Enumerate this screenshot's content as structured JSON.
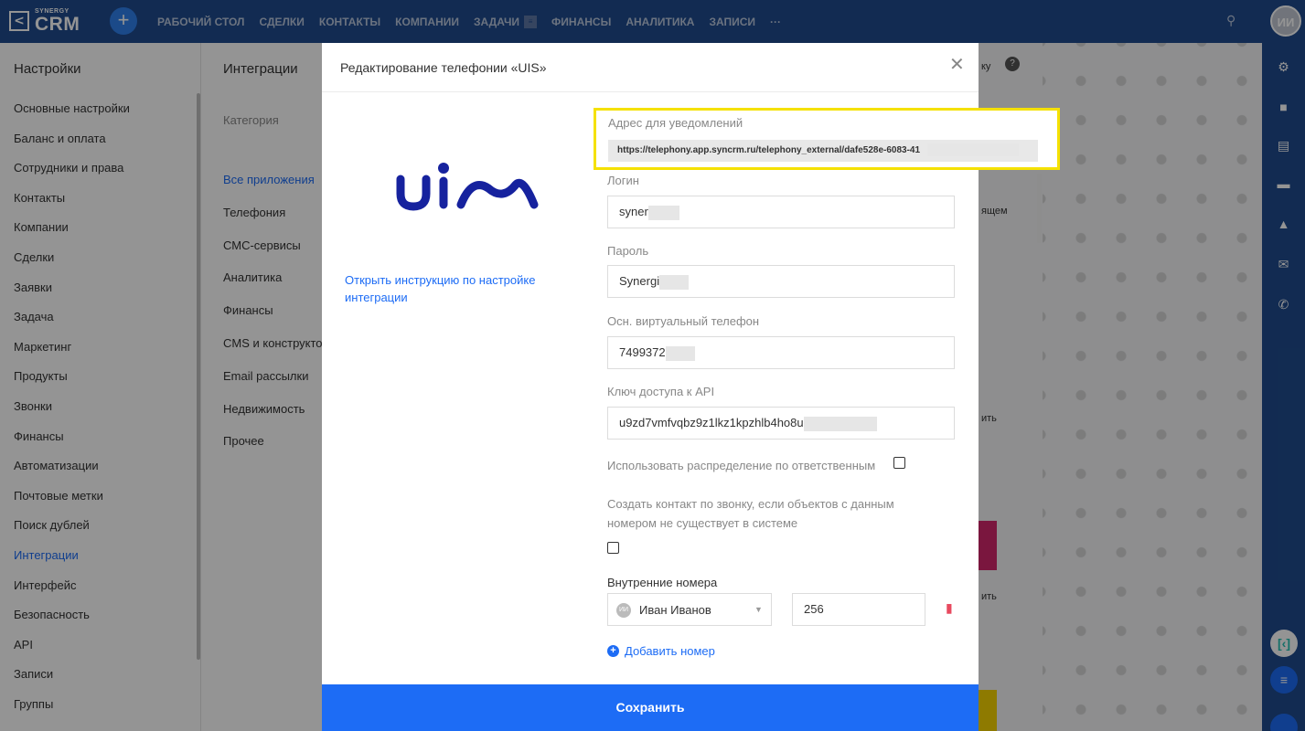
{
  "topbar": {
    "logo_small": "SYNERGY",
    "logo_big": "CRM",
    "nav": [
      "РАБОЧИЙ СТОЛ",
      "СДЕЛКИ",
      "КОНТАКТЫ",
      "КОМПАНИИ",
      "ЗАДАЧИ",
      "ФИНАНСЫ",
      "АНАЛИТИКА",
      "ЗАПИСИ",
      "···"
    ],
    "avatar": "ИИ"
  },
  "settings": {
    "title": "Настройки",
    "items": [
      "Основные настройки",
      "Баланс и оплата",
      "Сотрудники и права",
      "Контакты",
      "Компании",
      "Сделки",
      "Заявки",
      "Задача",
      "Маркетинг",
      "Продукты",
      "Звонки",
      "Финансы",
      "Автоматизации",
      "Почтовые метки",
      "Поиск дублей",
      "Интеграции",
      "Интерфейс",
      "Безопасность",
      "API",
      "Записи",
      "Группы"
    ],
    "active": "Интеграции"
  },
  "integrations": {
    "title": "Интеграции",
    "category_label": "Категория",
    "items": [
      "Все приложения",
      "Телефония",
      "СМС-сервисы",
      "Аналитика",
      "Финансы",
      "CMS и конструкто",
      "Email рассылки",
      "Недвижимость",
      "Прочее"
    ],
    "active": "Все приложения"
  },
  "background_peek": {
    "help": "ку",
    "t1": "ящем",
    "t2": "ить",
    "t3": "ить"
  },
  "modal": {
    "title": "Редактирование телефонии «UIS»",
    "logo_text": "uis",
    "instruction_link": "Открыть инструкцию по настройке интеграции",
    "notify": {
      "label": "Адрес для уведомлений",
      "url": "https://telephony.app.syncrm.ru/telephony_external/dafe528e-6083-41"
    },
    "login": {
      "label": "Логин",
      "value": "syner"
    },
    "password": {
      "label": "Пароль",
      "value": "Synergi"
    },
    "phone": {
      "label": "Осн. виртуальный телефон",
      "value": "7499372"
    },
    "api_key": {
      "label": "Ключ доступа к API",
      "value": "u9zd7vmfvqbz9z1lkz1kpzhlb4ho8u"
    },
    "use_distribution": {
      "label": "Использовать распределение по ответственным",
      "checked": false
    },
    "create_contact": {
      "label": "Создать контакт по звонку, если объектов с данным номером не существует в системе",
      "checked": false
    },
    "internal_numbers": {
      "label": "Внутренние номера",
      "user_avatar": "ИИ",
      "user": "Иван Иванов",
      "number": "256"
    },
    "add_number": "Добавить номер",
    "save": "Сохранить"
  },
  "colors": {
    "topbar": "#1f4b8e",
    "accent": "#1d6cf5",
    "highlight": "#f5e100",
    "delete": "#e84a5f"
  }
}
